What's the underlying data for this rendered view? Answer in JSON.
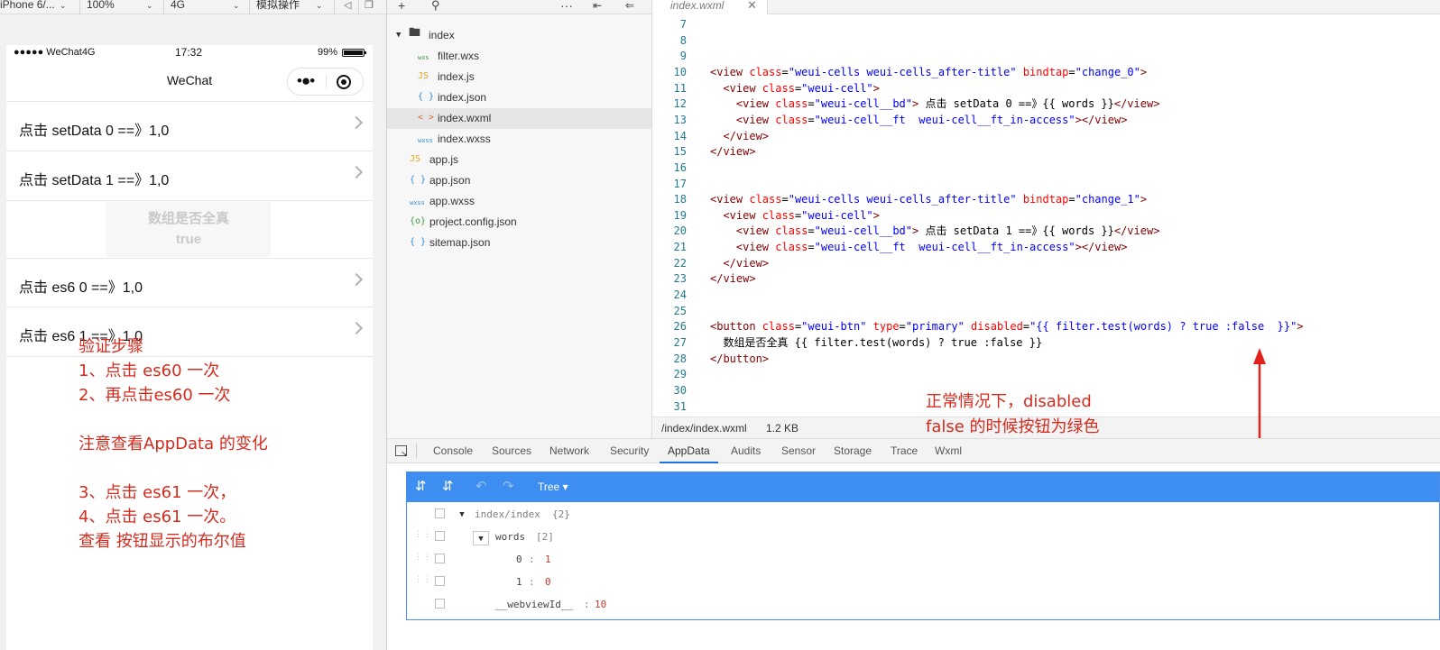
{
  "simulator": {
    "toolbar": {
      "device": "iPhone 6/...",
      "zoom": "100%",
      "network": "4G",
      "operation": "模拟操作"
    },
    "status_bar": {
      "carrier": "●●●●● WeChat4G",
      "time": "17:32",
      "battery_percent": "99%",
      "battery_level": 0.99
    },
    "nav_title": "WeChat",
    "cells": [
      "点击 setData 0 ==》1,0",
      "点击 setData 1 ==》1,0",
      "点击 es6 0 ==》1,0",
      "点击 es6 1 ==》1,0"
    ],
    "disabled_button": {
      "line1": "数组是否全真",
      "line2": "true"
    },
    "steps_note": "验证步骤\n1、点击 es60 一次\n2、再点击es60 一次\n\n注意查看AppData 的变化\n\n3、点击 es61 一次，\n4、点击 es61 一次。\n查看 按钮显示的布尔值"
  },
  "file_tree": {
    "folder": "index",
    "items": [
      {
        "name": "filter.wxs",
        "icon": "wxs-icon",
        "badge": "wxs",
        "color": "#3f9a3f"
      },
      {
        "name": "index.js",
        "icon": "js-icon",
        "badge": "JS",
        "color": "#e4a11b"
      },
      {
        "name": "index.json",
        "icon": "json-icon",
        "badge": "{ }",
        "color": "#2f8fd8"
      },
      {
        "name": "index.wxml",
        "icon": "wxml-icon",
        "badge": "< >",
        "color": "#e36a2e"
      },
      {
        "name": "index.wxss",
        "icon": "wxss-icon",
        "badge": "wxss",
        "color": "#2f8fd8"
      },
      {
        "name": "app.js",
        "icon": "js-icon",
        "badge": "JS",
        "color": "#e4a11b"
      },
      {
        "name": "app.json",
        "icon": "json-icon",
        "badge": "{ }",
        "color": "#2f8fd8"
      },
      {
        "name": "app.wxss",
        "icon": "wxss-icon",
        "badge": "wxss",
        "color": "#2f8fd8"
      },
      {
        "name": "project.config.json",
        "icon": "config-icon",
        "badge": "{o}",
        "color": "#3f9a3f"
      },
      {
        "name": "sitemap.json",
        "icon": "json-icon",
        "badge": "{ }",
        "color": "#2f8fd8"
      }
    ]
  },
  "editor": {
    "tab_name": "index.wxml",
    "lines": [
      {
        "n": "7",
        "t": ""
      },
      {
        "n": "8",
        "t": ""
      },
      {
        "n": "9",
        "t": ""
      },
      {
        "n": "10",
        "t": "<view class=\"weui-cells weui-cells_after-title\" bindtap=\"change_0\">"
      },
      {
        "n": "11",
        "t": "  <view class=\"weui-cell\">"
      },
      {
        "n": "12",
        "t": "    <view class=\"weui-cell__bd\"> 点击 setData 0 ==》{{ words }}</view>"
      },
      {
        "n": "13",
        "t": "    <view class=\"weui-cell__ft  weui-cell__ft_in-access\"></view>"
      },
      {
        "n": "14",
        "t": "  </view>"
      },
      {
        "n": "15",
        "t": "</view>"
      },
      {
        "n": "16",
        "t": ""
      },
      {
        "n": "17",
        "t": ""
      },
      {
        "n": "18",
        "t": "<view class=\"weui-cells weui-cells_after-title\" bindtap=\"change_1\">"
      },
      {
        "n": "19",
        "t": "  <view class=\"weui-cell\">"
      },
      {
        "n": "20",
        "t": "    <view class=\"weui-cell__bd\"> 点击 setData 1 ==》{{ words }}</view>"
      },
      {
        "n": "21",
        "t": "    <view class=\"weui-cell__ft  weui-cell__ft_in-access\"></view>"
      },
      {
        "n": "22",
        "t": "  </view>"
      },
      {
        "n": "23",
        "t": "</view>"
      },
      {
        "n": "24",
        "t": ""
      },
      {
        "n": "25",
        "t": ""
      },
      {
        "n": "26",
        "t": "<button class=\"weui-btn\" type=\"primary\" disabled=\"{{ filter.test(words) ? true :false  }}\">"
      },
      {
        "n": "27",
        "t": "  数组是否全真 {{ filter.test(words) ? true :false }}"
      },
      {
        "n": "28",
        "t": "</button>"
      },
      {
        "n": "29",
        "t": ""
      },
      {
        "n": "30",
        "t": ""
      },
      {
        "n": "31",
        "t": ""
      }
    ],
    "status_path": "/index/index.wxml",
    "status_size": "1.2 KB",
    "note": "正常情况下，disabled\nfalse 的时候按钮为绿色\ntrue 的时候按钮为灰色"
  },
  "devtools": {
    "tabs": [
      "Console",
      "Sources",
      "Network",
      "Security",
      "AppData",
      "Audits",
      "Sensor",
      "Storage",
      "Trace",
      "Wxml"
    ],
    "active_tab": "AppData",
    "mode": "Tree",
    "rows": [
      {
        "key": "index/index",
        "value": "{2}"
      },
      {
        "key": "words",
        "value": "[2]"
      },
      {
        "key": "0",
        "value": "1"
      },
      {
        "key": "1",
        "value": "0"
      },
      {
        "key": "__webviewId__",
        "value": "10"
      }
    ]
  },
  "colors": {
    "annotation_red": "#d42b1e",
    "appdata_blue": "#3d8ef0",
    "active_tab_underline": "#1a73e8"
  }
}
